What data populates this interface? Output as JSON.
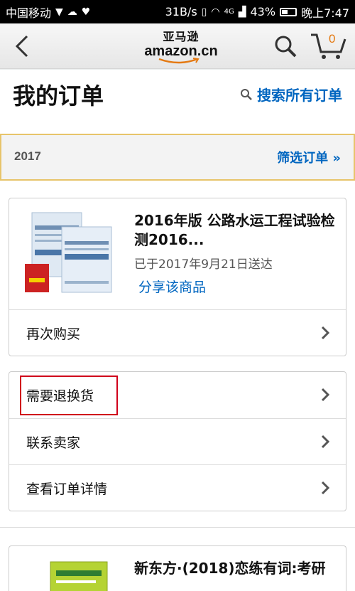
{
  "status_bar": {
    "carrier": "中国移动",
    "speed": "31B/s",
    "signal": "4G",
    "battery": "43%",
    "battery_level": 0.43,
    "time": "晚上7:47"
  },
  "header": {
    "logo_cn": "亚马逊",
    "logo_en": "amazon.cn",
    "cart_count": "0"
  },
  "page": {
    "title": "我的订单",
    "search_all": "搜索所有订单"
  },
  "filter": {
    "year": "2017",
    "filter_link": "筛选订单 »"
  },
  "order1": {
    "product_title": "2016年版 公路水运工程试验检测2016...",
    "status": "已于2017年9月21日送达",
    "share": "分享该商品",
    "buy_again": "再次购买"
  },
  "order1_actions": {
    "return": "需要退换货",
    "contact_seller": "联系卖家",
    "view_details": "查看订单详情"
  },
  "order2": {
    "product_title": "新东方·(2018)恋练有词:考研"
  },
  "colors": {
    "link": "#0066c0",
    "accent": "#e47911",
    "highlight": "#d0021b"
  }
}
